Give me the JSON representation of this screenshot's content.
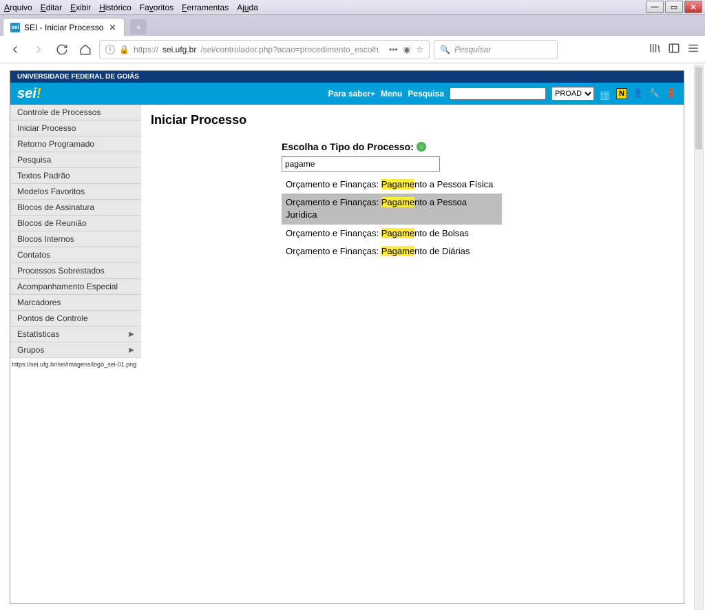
{
  "browser": {
    "menu": [
      "Arquivo",
      "Editar",
      "Exibir",
      "Histórico",
      "Favoritos",
      "Ferramentas",
      "Ajuda"
    ],
    "tab_title": "SEI - Iniciar Processo",
    "url_prefix": "https://",
    "url_domain": "sei.ufg.br",
    "url_path": "/sei/controlador.php?acao=procedimento_escolh",
    "search_placeholder": "Pesquisar",
    "status_url": "https://sei.ufg.br/sei/imagens/logo_sei-01.png"
  },
  "sei": {
    "org": "UNIVERSIDADE FEDERAL DE GOIÁS",
    "logo": "sei!",
    "header_links": [
      "Para saber+",
      "Menu",
      "Pesquisa"
    ],
    "unit_select": "PROAD",
    "sidebar": {
      "items": [
        "Controle de Processos",
        "Iniciar Processo",
        "Retorno Programado",
        "Pesquisa",
        "Textos Padrão",
        "Modelos Favoritos",
        "Blocos de Assinatura",
        "Blocos de Reunião",
        "Blocos Internos",
        "Contatos",
        "Processos Sobrestados",
        "Acompanhamento Especial",
        "Marcadores",
        "Pontos de Controle"
      ],
      "expandable": [
        "Estatísticas",
        "Grupos"
      ]
    },
    "main": {
      "title": "Iniciar Processo",
      "choose_label": "Escolha o Tipo do Processo:",
      "filter_value": "pagame",
      "results": [
        {
          "pre": "Orçamento e Finanças: ",
          "hl": "Pagame",
          "post": "nto a Pessoa Física",
          "hover": false
        },
        {
          "pre": "Orçamento e Finanças: ",
          "hl": "Pagame",
          "post": "nto a Pessoa Jurídica",
          "hover": true
        },
        {
          "pre": "Orçamento e Finanças: ",
          "hl": "Pagame",
          "post": "nto de Bolsas",
          "hover": false
        },
        {
          "pre": "Orçamento e Finanças: ",
          "hl": "Pagame",
          "post": "nto de Diárias",
          "hover": false
        }
      ]
    }
  }
}
